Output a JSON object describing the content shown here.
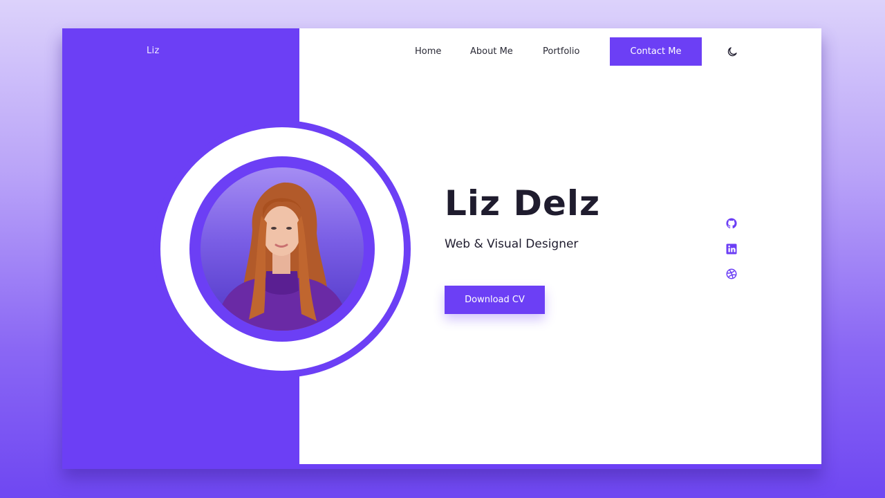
{
  "brand": {
    "name": "Liz"
  },
  "nav": {
    "links": [
      {
        "label": "Home"
      },
      {
        "label": "About Me"
      },
      {
        "label": "Portfolio"
      }
    ],
    "contact_label": "Contact Me",
    "theme_toggle_icon": "moon-icon"
  },
  "hero": {
    "name": "Liz Delz",
    "role": "Web & Visual Designer",
    "cta_label": "Download CV",
    "photo_alt": "Portrait of Liz Delz"
  },
  "social": [
    {
      "name": "GitHub",
      "icon": "github-icon"
    },
    {
      "name": "LinkedIn",
      "icon": "linkedin-icon"
    },
    {
      "name": "Dribbble",
      "icon": "dribbble-icon"
    }
  ],
  "colors": {
    "accent": "#6c3ff5",
    "text": "#1f1c2e",
    "surface": "#ffffff"
  }
}
